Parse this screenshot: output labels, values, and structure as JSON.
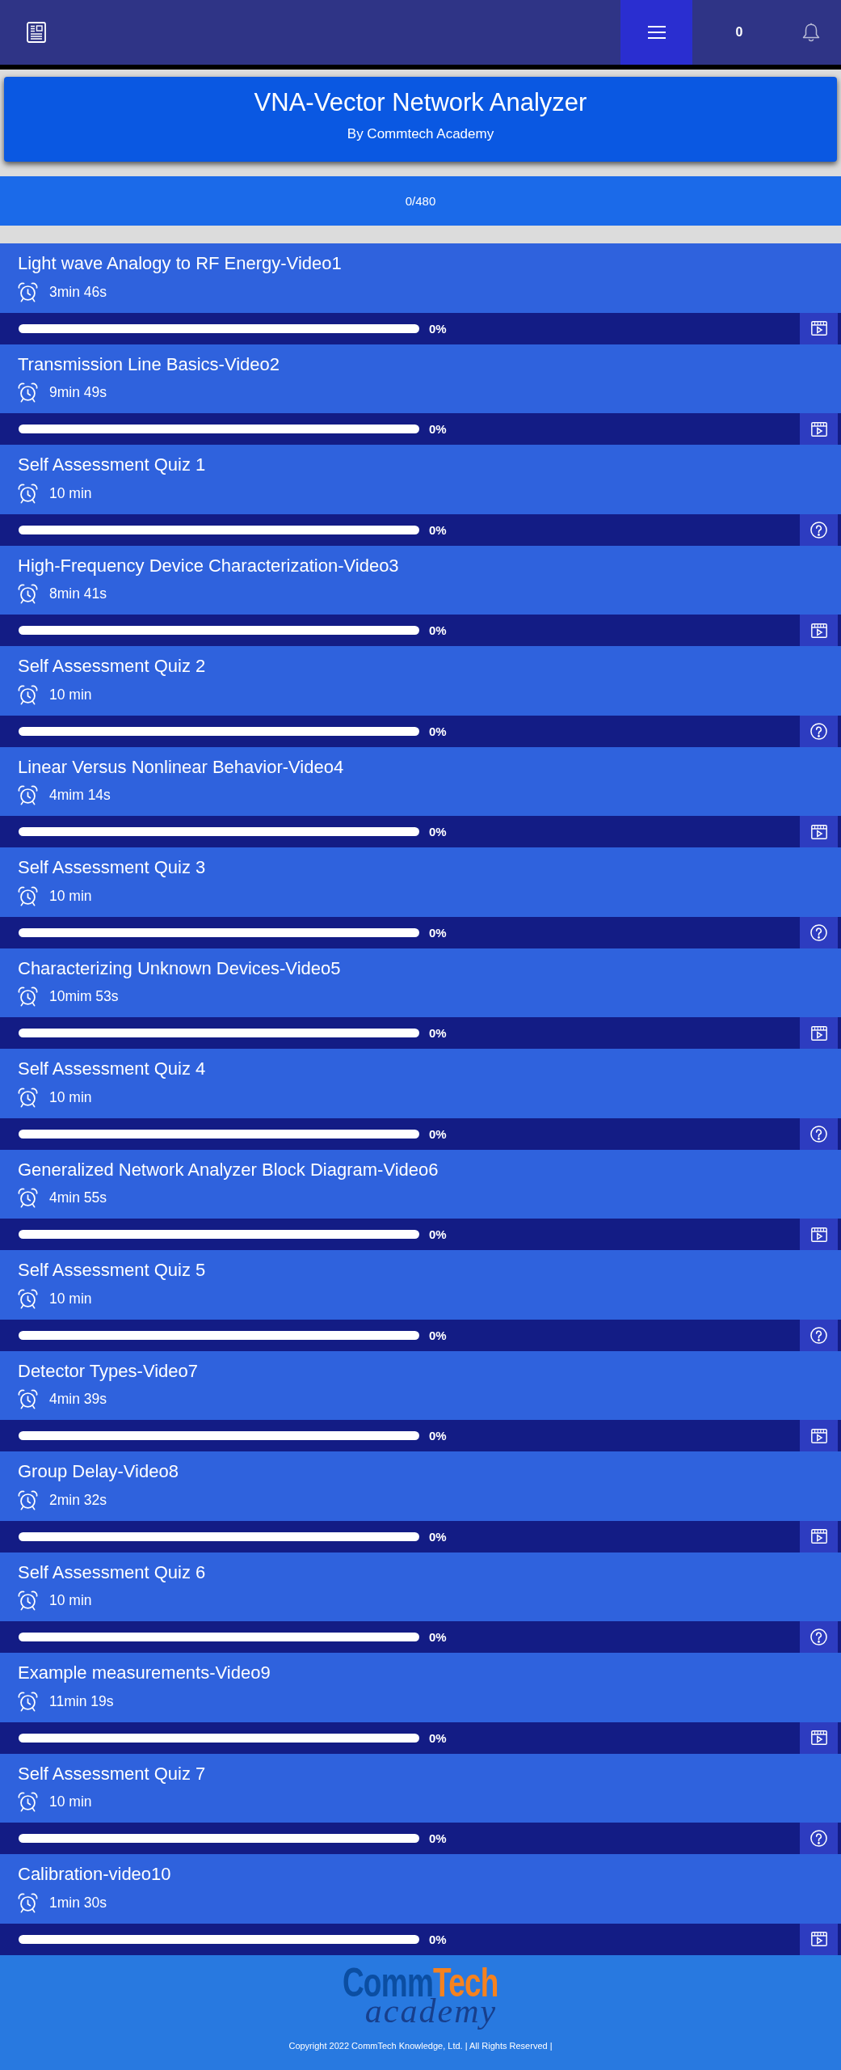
{
  "topbar": {
    "count": "0"
  },
  "course": {
    "title": "VNA-Vector Network Analyzer",
    "subtitle": "By Commtech Academy"
  },
  "progress": {
    "reading": "0/480"
  },
  "lessons": [
    {
      "kind": "video",
      "title": "Light wave Analogy to RF Energy-Video1",
      "duration": "3min 46s",
      "level": 0,
      "reading": "0%"
    },
    {
      "kind": "video",
      "title": "Transmission Line Basics-Video2",
      "duration": "9min 49s",
      "level": 0,
      "reading": "0%"
    },
    {
      "kind": "quiz",
      "title": "Self Assessment Quiz 1",
      "duration": "10 min",
      "level": 0,
      "reading": "0%"
    },
    {
      "kind": "video",
      "title": "High-Frequency Device Characterization-Video3",
      "duration": "8min 41s",
      "level": 0,
      "reading": "0%"
    },
    {
      "kind": "quiz",
      "title": "Self Assessment Quiz 2",
      "duration": "10 min",
      "level": 0,
      "reading": "0%"
    },
    {
      "kind": "video",
      "title": "Linear Versus Nonlinear Behavior-Video4",
      "duration": "4mim 14s",
      "level": 0,
      "reading": "0%"
    },
    {
      "kind": "quiz",
      "title": "Self Assessment Quiz 3",
      "duration": "10 min",
      "level": 0,
      "reading": "0%"
    },
    {
      "kind": "video",
      "title": "Characterizing Unknown Devices-Video5",
      "duration": "10mim 53s",
      "level": 0,
      "reading": "0%"
    },
    {
      "kind": "quiz",
      "title": "Self Assessment Quiz 4",
      "duration": "10 min",
      "level": 0,
      "reading": "0%"
    },
    {
      "kind": "video",
      "title": "Generalized Network Analyzer Block Diagram-Video6",
      "duration": "4min 55s",
      "level": 0,
      "reading": "0%"
    },
    {
      "kind": "quiz",
      "title": "Self Assessment Quiz 5",
      "duration": "10 min",
      "level": 0,
      "reading": "0%"
    },
    {
      "kind": "video",
      "title": "Detector Types-Video7",
      "duration": "4min 39s",
      "level": 0,
      "reading": "0%"
    },
    {
      "kind": "video",
      "title": "Group Delay-Video8",
      "duration": "2min 32s",
      "level": 0,
      "reading": "0%"
    },
    {
      "kind": "quiz",
      "title": "Self Assessment Quiz 6",
      "duration": "10 min",
      "level": 0,
      "reading": "0%"
    },
    {
      "kind": "video",
      "title": "Example measurements-Video9",
      "duration": "11min 19s",
      "level": 0,
      "reading": "0%"
    },
    {
      "kind": "quiz",
      "title": "Self Assessment Quiz 7",
      "duration": "10 min",
      "level": 0,
      "reading": "0%"
    },
    {
      "kind": "video",
      "title": "Calibration-video10",
      "duration": "1min 30s",
      "level": 0,
      "reading": "0%"
    }
  ],
  "footer": {
    "logo": {
      "lead": "Comm",
      "accent": "Tech",
      "tagline": "academy"
    },
    "copyright": "Copyright 2022 CommTech Knowledge, Ltd. | All Rights Reserved |"
  }
}
